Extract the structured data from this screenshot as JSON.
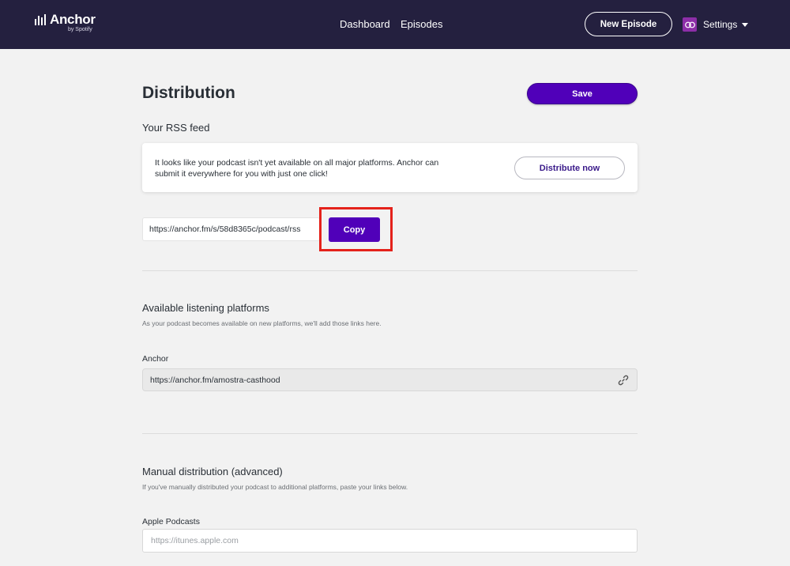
{
  "brand": {
    "name": "Anchor",
    "sub": "by Spotify"
  },
  "nav": {
    "dashboard": "Dashboard",
    "episodes": "Episodes",
    "new_episode": "New Episode",
    "settings": "Settings"
  },
  "page": {
    "title": "Distribution",
    "save_label": "Save"
  },
  "rss": {
    "heading": "Your RSS feed",
    "notice": "It looks like your podcast isn't yet available on all major platforms. Anchor can submit it everywhere for you with just one click!",
    "distribute_label": "Distribute now",
    "feed_url": "https://anchor.fm/s/58d8365c/podcast/rss",
    "copy_label": "Copy"
  },
  "platforms": {
    "heading": "Available listening platforms",
    "subheading": "As your podcast becomes available on new platforms, we'll add those links here.",
    "items": [
      {
        "name": "Anchor",
        "url": "https://anchor.fm/amostra-casthood"
      }
    ]
  },
  "manual": {
    "heading": "Manual distribution (advanced)",
    "subheading": "If you've manually distributed your podcast to additional platforms, paste your links below.",
    "apple_label": "Apple Podcasts",
    "apple_placeholder": "https://itunes.apple.com",
    "apple_value": ""
  },
  "colors": {
    "nav_bg": "#24203f",
    "accent": "#5000b9",
    "highlight": "#e4221b",
    "page_bg": "#f2f2f2"
  }
}
